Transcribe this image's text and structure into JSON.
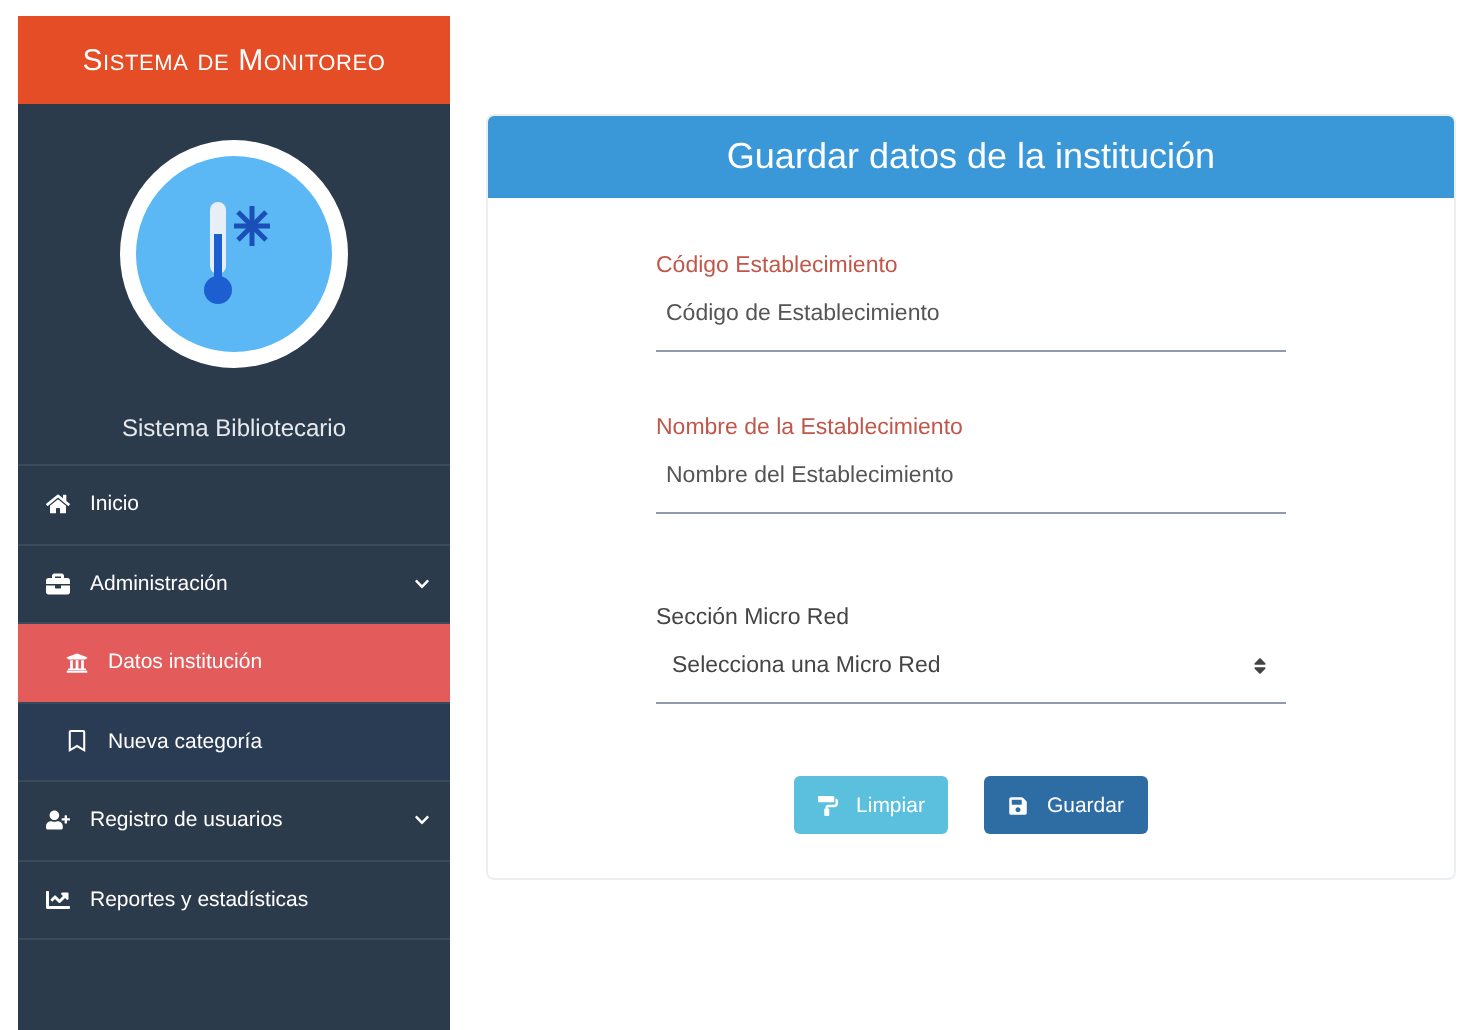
{
  "sidebar": {
    "title": "Sistema de Monitoreo",
    "profile_name": "Sistema Bibliotecario",
    "items": [
      {
        "label": "Inicio",
        "has_submenu": false,
        "selected": false
      },
      {
        "label": "Administración",
        "has_submenu": true,
        "selected": false,
        "children": [
          {
            "label": "Datos institución",
            "selected": true
          },
          {
            "label": "Nueva categoría",
            "selected": false
          }
        ]
      },
      {
        "label": "Registro de usuarios",
        "has_submenu": true,
        "selected": false
      },
      {
        "label": "Reportes y estadísticas",
        "has_submenu": false,
        "selected": false
      }
    ]
  },
  "form": {
    "title": "Guardar datos de la institución",
    "fields": [
      {
        "kind": "text",
        "label": "Código Establecimiento",
        "placeholder": "Código de Establecimiento"
      },
      {
        "kind": "text",
        "label": "Nombre de la Establecimiento",
        "placeholder": "Nombre del Establecimiento"
      },
      {
        "kind": "select",
        "label": "Sección Micro Red",
        "value": "Selecciona una Micro Red"
      }
    ],
    "buttons": [
      {
        "kind": "clear",
        "label": "Limpiar"
      },
      {
        "kind": "save",
        "label": "Guardar"
      }
    ]
  }
}
